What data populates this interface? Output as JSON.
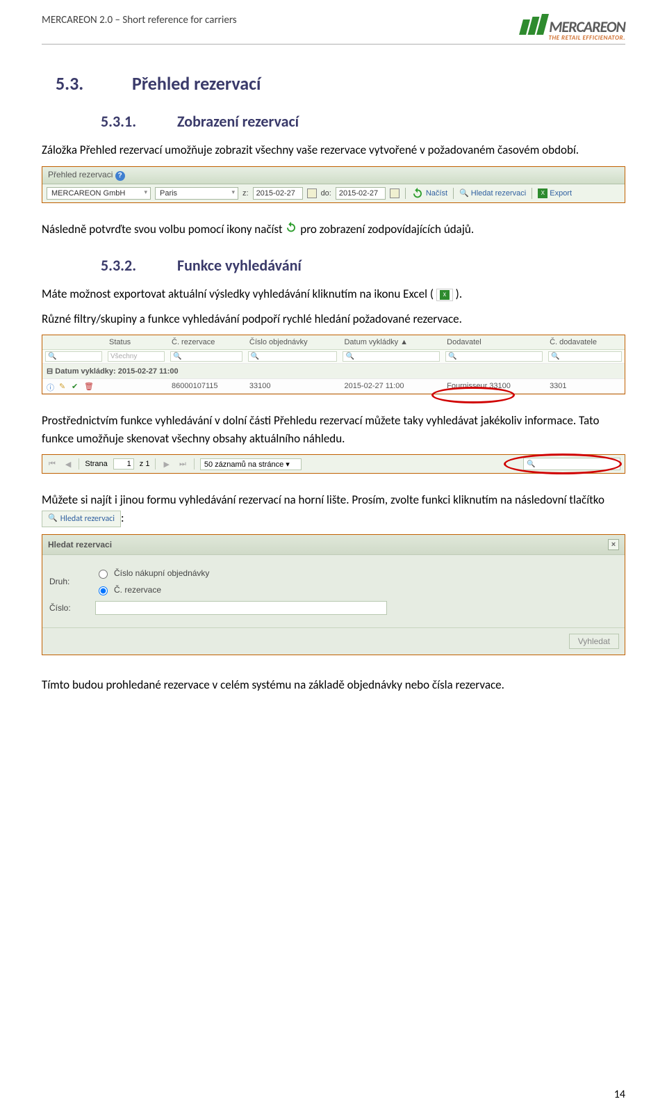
{
  "header": {
    "doc_title": "MERCAREON 2.0 – Short reference for carriers",
    "logo_text": "MERCAREON",
    "logo_sub": "THE RETAIL EFFICIENATOR."
  },
  "h2": {
    "num": "5.3.",
    "title": "Přehled rezervací"
  },
  "h3a": {
    "num": "5.3.1.",
    "title": "Zobrazení rezervací"
  },
  "p1": "Záložka Přehled rezervací umožňuje zobrazit všechny  vaše rezervace vytvořené v požadovaném časovém období.",
  "sshot1": {
    "title": "Přehled rezervaci",
    "company": "MERCAREON GmbH",
    "location": "Paris",
    "z_lbl": "z:",
    "do_lbl": "do:",
    "date_from": "2015-02-27",
    "date_to": "2015-02-27",
    "nacist": "Načíst",
    "hledat": "Hledat rezervaci",
    "export": "Export"
  },
  "p2a": "Následně potvrďte svou volbu pomocí ikony načíst ",
  "p2b": " pro zobrazení zodpovídajících údajů.",
  "h3b": {
    "num": "5.3.2.",
    "title": "Funkce vyhledávání"
  },
  "p3a": "Máte možnost exportovat aktuální výsledky vyhledávání kliknutím na ikonu Excel ( ",
  "p3b": " ).",
  "p4": "Různé filtry/skupiny a funkce vyhledávání podpoří rychlé hledání požadované rezervace.",
  "sshot2": {
    "cols": [
      "",
      "Status",
      "Č. rezervace",
      "Číslo objednávky",
      "Datum vykládky ▲",
      "Dodavatel",
      "Č. dodavatele"
    ],
    "filter_status": "Všechny",
    "group_label": "Datum vykládky: 2015-02-27 11:00",
    "row": {
      "rez": "86000107115",
      "obj": "33100",
      "datum": "2015-02-27 11:00",
      "dodavatel": "Fournisseur 33100",
      "cdod": "3301"
    }
  },
  "p5": "Prostřednictvím funkce vyhledávání v dolní části Přehledu rezervací můžete taky vyhledávat jakékoliv informace. Tato funkce umožňuje skenovat všechny obsahy aktuálního náhledu.",
  "sshot3": {
    "strana": "Strana",
    "page": "1",
    "z": "z 1",
    "perpage": "50 záznamů na stránce"
  },
  "p6a": "Můžete si najít i jinou formu vyhledávání rezervací na horní lište. Prosím, zvolte funkci kliknutím na následovní tlačítko ",
  "p6b": ":",
  "hledat_btn_label": "Hledat rezervaci",
  "sshot4": {
    "title": "Hledat rezervaci",
    "druh_lbl": "Druh:",
    "opt1": "Číslo nákupní objednávky",
    "opt2": "Č. rezervace",
    "cislo_lbl": "Číslo:",
    "vyhledat": "Vyhledat"
  },
  "p7": "Tímto budou prohledané rezervace v celém systému na základě objednávky nebo čísla rezervace.",
  "page_num": "14"
}
